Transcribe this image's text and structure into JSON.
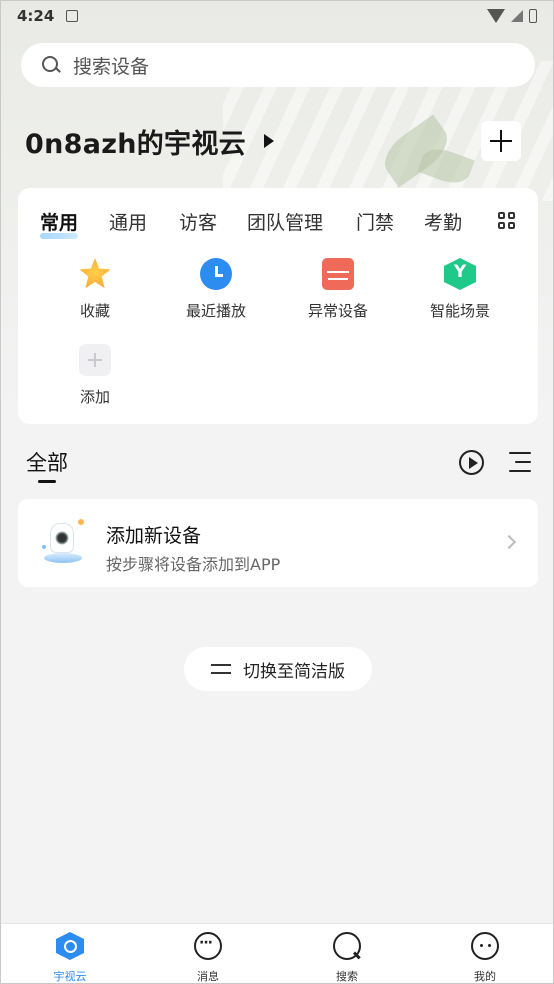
{
  "status_bar": {
    "time": "4:24"
  },
  "search": {
    "placeholder": "搜索设备"
  },
  "header": {
    "title": "0n8azh的宇视云"
  },
  "tabs": [
    {
      "label": "常用",
      "active": true
    },
    {
      "label": "通用",
      "active": false
    },
    {
      "label": "访客",
      "active": false
    },
    {
      "label": "团队管理",
      "active": false
    },
    {
      "label": "门禁",
      "active": false
    },
    {
      "label": "考勤",
      "active": false
    }
  ],
  "shortcuts": [
    {
      "label": "收藏",
      "icon": "star-icon",
      "color": "#ff9a2e"
    },
    {
      "label": "最近播放",
      "icon": "clock-icon",
      "color": "#2d8cf0"
    },
    {
      "label": "异常设备",
      "icon": "alert-device-icon",
      "color": "#f06a5a"
    },
    {
      "label": "智能场景",
      "icon": "scene-icon",
      "color": "#1fc98a"
    },
    {
      "label": "添加",
      "icon": "add-icon",
      "color": "#f0f0f2"
    }
  ],
  "section": {
    "title": "全部"
  },
  "add_device": {
    "title": "添加新设备",
    "subtitle": "按步骤将设备添加到APP"
  },
  "switch_button": {
    "label": "切换至简洁版"
  },
  "bottom_nav": [
    {
      "label": "宇视云",
      "icon": "home-icon",
      "active": true
    },
    {
      "label": "消息",
      "icon": "message-icon",
      "active": false
    },
    {
      "label": "搜索",
      "icon": "search-icon",
      "active": false
    },
    {
      "label": "我的",
      "icon": "profile-icon",
      "active": false
    }
  ],
  "colors": {
    "accent": "#2d8cf0",
    "background": "#f3f3f4"
  }
}
